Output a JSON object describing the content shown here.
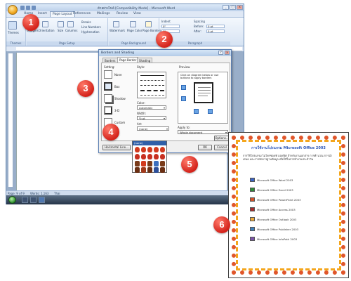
{
  "word": {
    "title": "ตัวอย่างไฟล์ [Compatibility Mode] - Microsoft Word",
    "tabs": [
      "Home",
      "Insert",
      "Page Layout",
      "References",
      "Mailings",
      "Review",
      "View"
    ],
    "ribbon": {
      "groups": [
        "Themes",
        "Page Setup",
        "Page Background",
        "Paragraph"
      ],
      "themes_label": "Themes",
      "margins_label": "Margins",
      "orientation_label": "Orientation",
      "size_label": "Size",
      "columns_label": "Columns",
      "breaks_label": "Breaks",
      "line_numbers_label": "Line Numbers",
      "hyphenation_label": "Hyphenation",
      "watermark_label": "Watermark",
      "page_color_label": "Page Color",
      "page_borders_label": "Page Borders",
      "indent_label": "Indent",
      "spacing_label": "Spacing",
      "before_label": "Before:",
      "after_label": "After:",
      "indent_left_value": "0\"",
      "indent_right_value": "0\"",
      "spacing_before_value": "0 pt",
      "spacing_after_value": "0 pt"
    },
    "status": {
      "page": "Page: 9 of 9",
      "words": "Words: 1,163",
      "language": "Thai"
    }
  },
  "dialog": {
    "title": "Borders and Shading",
    "tabs": [
      "Borders",
      "Page Border",
      "Shading"
    ],
    "setting_label": "Setting:",
    "settings": [
      "None",
      "Box",
      "Shadow",
      "3-D",
      "Custom"
    ],
    "style_label": "Style:",
    "color_label": "Color:",
    "color_value": "Automatic",
    "width_label": "Width:",
    "width_value": "½ pt",
    "art_label": "Art:",
    "art_value": "(none)",
    "art_selected": "(none)",
    "preview_label": "Preview",
    "preview_hint": "Click on diagram below or use buttons to apply borders",
    "apply_to_label": "Apply to:",
    "apply_to_value": "Whole document",
    "options_button": "Options...",
    "horizontal_line_button": "Horizontal Line...",
    "ok_button": "OK",
    "cancel_button": "Cancel"
  },
  "callouts": [
    "1",
    "2",
    "3",
    "4",
    "5",
    "6"
  ],
  "result": {
    "title": "การใช้งานโปรแกรม Microsoft Office 2003",
    "intro": "การใช้โปรแกรม ไมโครซอฟท์ ออฟฟิศ สำหรับงานเอกสาร การคำนวณ การนำเสนอ และการจัดการฐานข้อมูล เพื่อใช้ในการทำงานประจำวัน",
    "items": [
      "Microsoft Office Word 2003",
      "Microsoft Office Excel 2003",
      "Microsoft Office PowerPoint 2003",
      "Microsoft Office Access 2003",
      "Microsoft Office Outlook 2003",
      "Microsoft Office Publisher 2003",
      "Microsoft Office InfoPath 2003"
    ]
  },
  "colors": {
    "callout": "#d4231b",
    "ribbon": "#dfe8f5",
    "dialog_title": "#b3cbe8",
    "border_art": "#e0562a"
  }
}
